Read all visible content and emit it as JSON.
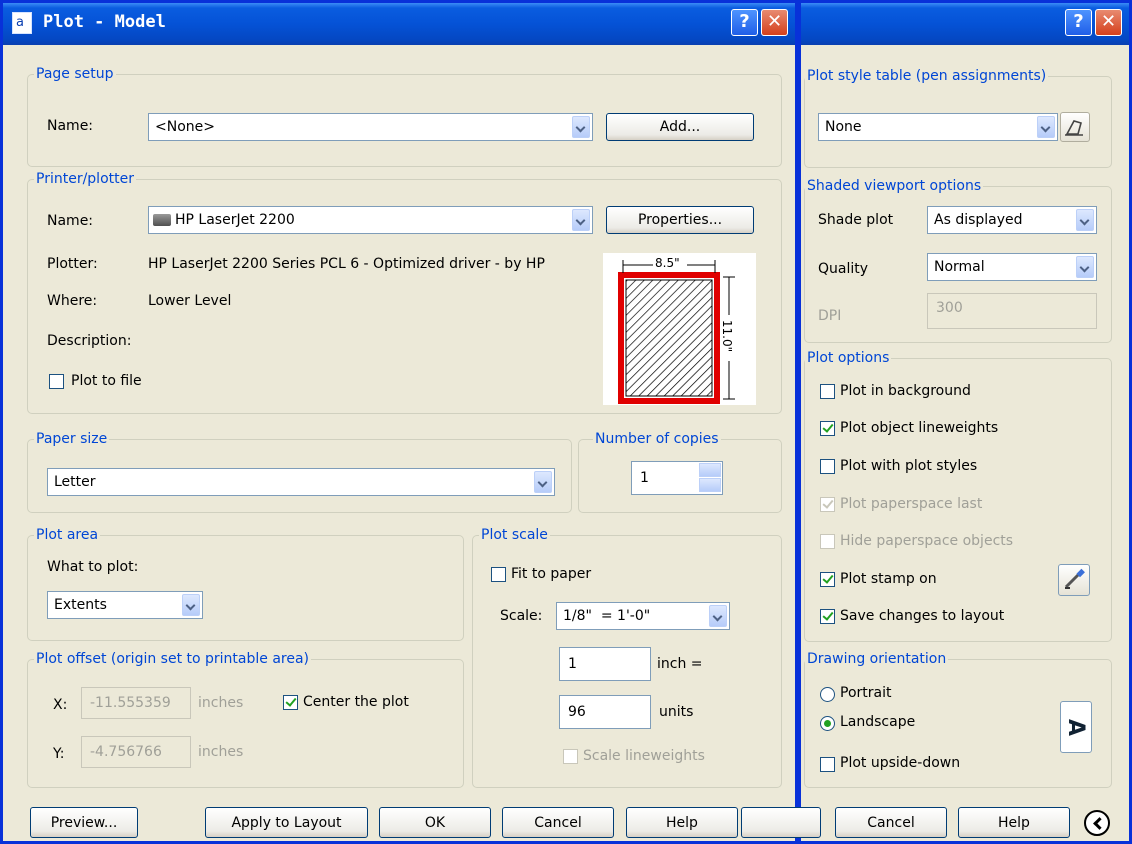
{
  "main_window": {
    "title": "Plot - Model",
    "page_setup": {
      "legend": "Page setup",
      "name_label": "Name:",
      "name_value": "<None>",
      "add_button": "Add..."
    },
    "printer": {
      "legend": "Printer/plotter",
      "name_label": "Name:",
      "name_value": "HP LaserJet 2200",
      "properties_button": "Properties...",
      "plotter_label": "Plotter:",
      "plotter_value": "HP LaserJet 2200 Series PCL 6 - Optimized driver - by HP",
      "where_label": "Where:",
      "where_value": "Lower Level",
      "description_label": "Description:",
      "plot_to_file_label": "Plot to file",
      "plot_to_file_checked": false,
      "preview_width_label": "8.5\"",
      "preview_height_label": "11.0\""
    },
    "paper_size": {
      "legend": "Paper size",
      "value": "Letter"
    },
    "copies": {
      "legend": "Number of copies",
      "value": "1"
    },
    "plot_area": {
      "legend": "Plot area",
      "what_label": "What to plot:",
      "what_value": "Extents"
    },
    "plot_scale": {
      "legend": "Plot scale",
      "fit_label": "Fit to paper",
      "fit_checked": false,
      "scale_label": "Scale:",
      "scale_value": "1/8\"  = 1'-0\"",
      "inch_value": "1",
      "inch_label": "inch =",
      "units_value": "96",
      "units_label": "units",
      "scale_lineweights_label": "Scale lineweights",
      "scale_lineweights_checked": false
    },
    "plot_offset": {
      "legend": "Plot offset (origin set to printable area)",
      "x_label": "X:",
      "x_value": "-11.555359",
      "x_units": "inches",
      "y_label": "Y:",
      "y_value": "-4.756766",
      "y_units": "inches",
      "center_label": "Center the plot",
      "center_checked": true
    },
    "buttons": {
      "preview": "Preview...",
      "apply": "Apply to Layout",
      "ok": "OK",
      "cancel": "Cancel",
      "help": "Help"
    }
  },
  "extended_panel": {
    "plot_style": {
      "legend": "Plot style table (pen assignments)",
      "value": "None"
    },
    "shaded_viewport": {
      "legend": "Shaded viewport options",
      "shade_label": "Shade plot",
      "shade_value": "As displayed",
      "quality_label": "Quality",
      "quality_value": "Normal",
      "dpi_label": "DPI",
      "dpi_value": "300"
    },
    "plot_options": {
      "legend": "Plot options",
      "items": [
        {
          "label": "Plot in background",
          "checked": false,
          "enabled": true
        },
        {
          "label": "Plot object lineweights",
          "checked": true,
          "enabled": true
        },
        {
          "label": "Plot with plot styles",
          "checked": false,
          "enabled": true
        },
        {
          "label": "Plot paperspace last",
          "checked": true,
          "enabled": false
        },
        {
          "label": "Hide paperspace objects",
          "checked": false,
          "enabled": false
        },
        {
          "label": "Plot stamp on",
          "checked": true,
          "enabled": true
        },
        {
          "label": "Save changes to layout",
          "checked": true,
          "enabled": true
        }
      ]
    },
    "orientation": {
      "legend": "Drawing orientation",
      "portrait_label": "Portrait",
      "landscape_label": "Landscape",
      "selected": "Landscape",
      "upside_down_label": "Plot upside-down",
      "upside_down_checked": false,
      "preview_glyph": "A"
    },
    "buttons": {
      "cancel": "Cancel",
      "help": "Help"
    }
  }
}
